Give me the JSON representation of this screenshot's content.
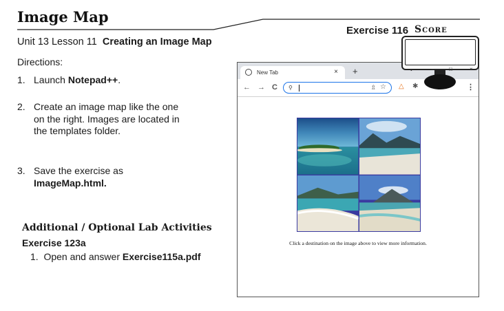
{
  "header": {
    "title": "Image Map",
    "lesson_prefix": "Unit 13 Lesson 11",
    "lesson_title": "Creating an Image Map",
    "exercise": "Exercise 116",
    "score": "Score"
  },
  "directions": {
    "heading": "Directions:",
    "steps": [
      {
        "num": "1.",
        "pre": "Launch ",
        "bold": "Notepad++",
        "post": "."
      },
      {
        "num": "2.",
        "text": "Create an image map like the one on the right. Images are located in the templates folder."
      },
      {
        "num": "3.",
        "pre": "Save the exercise as",
        "bold": "ImageMap.html."
      }
    ]
  },
  "additional": {
    "heading": "Additional / Optional Lab Activities",
    "exercise": "Exercise 123a",
    "item_num": "1.",
    "item_pre": "Open and answer ",
    "item_bold": "Exercise115a.pdf"
  },
  "browser": {
    "tab_label": "New Tab",
    "tab_close": "×",
    "new_tab": "+",
    "nav_back": "←",
    "nav_forward": "→",
    "nav_reload": "C",
    "menu": "⋮",
    "caption": "Click a destination on the image above to view more information."
  },
  "window_controls": {
    "minimize": "−",
    "maximize": "□",
    "close": "×",
    "dropdown": "⌄"
  },
  "colors": {
    "accent_blue": "#1a73e8",
    "image_border": "#3a3aa0"
  }
}
